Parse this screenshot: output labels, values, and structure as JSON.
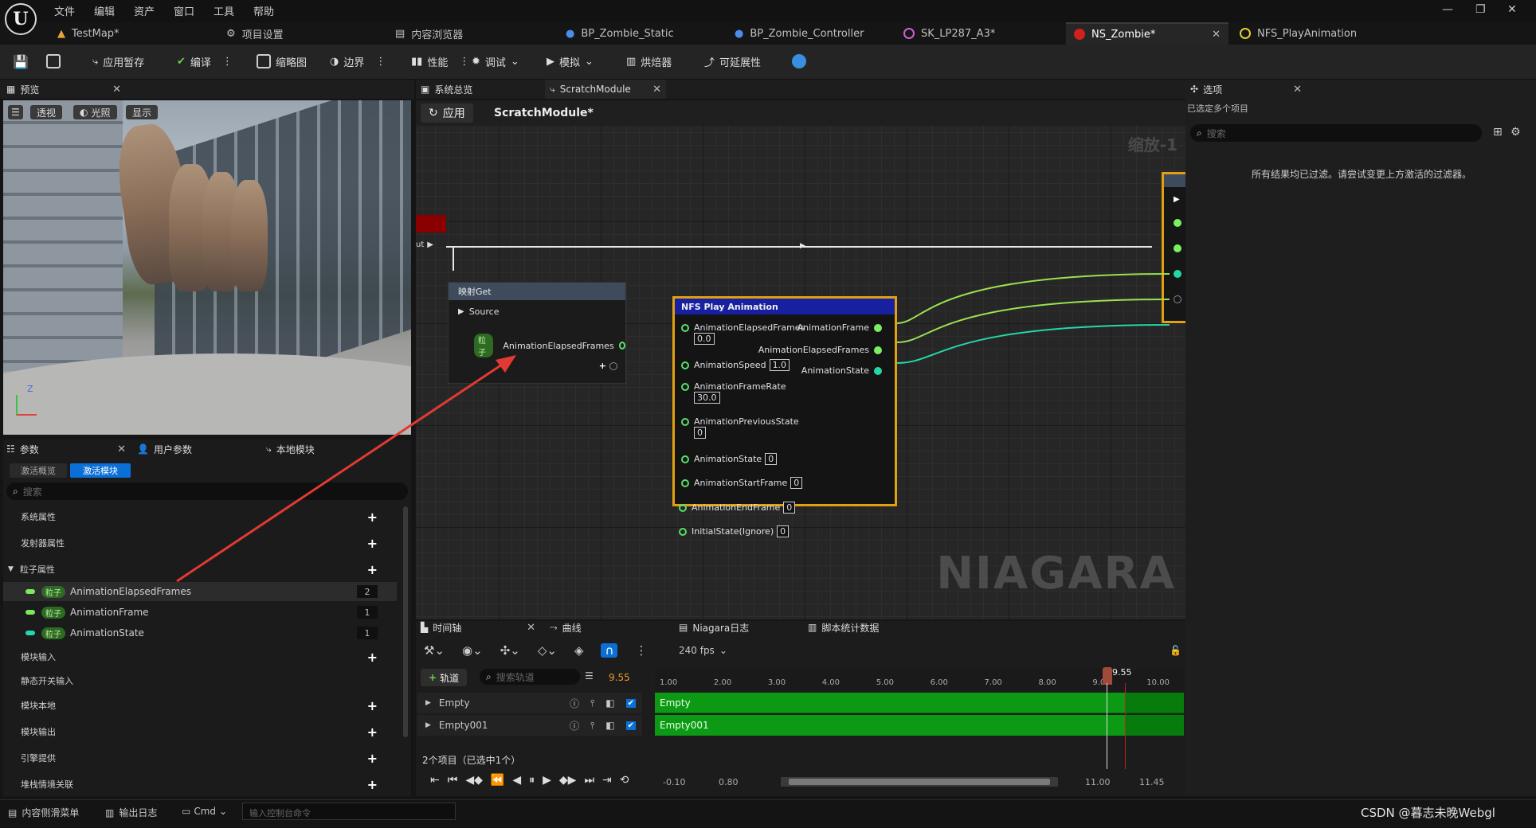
{
  "app": {
    "menu": [
      "文件",
      "编辑",
      "资产",
      "窗口",
      "工具",
      "帮助"
    ]
  },
  "tabs": [
    {
      "label": "TestMap*"
    },
    {
      "label": "项目设置"
    },
    {
      "label": "内容浏览器"
    },
    {
      "label": "BP_Zombie_Static"
    },
    {
      "label": "BP_Zombie_Controller"
    },
    {
      "label": "SK_LP287_A3*"
    },
    {
      "label": "NS_Zombie*"
    },
    {
      "label": "NFS_PlayAnimation"
    }
  ],
  "toolbar": {
    "apply_temp": "应用暂存",
    "compile": "编译",
    "thumbnail": "缩略图",
    "bounds": "边界",
    "performance": "性能",
    "debug": "调试",
    "simulate": "模拟",
    "baker": "烘焙器",
    "scalability": "可延展性"
  },
  "preview": {
    "tab": "预览",
    "buttons": [
      "透视",
      "光照",
      "显示"
    ],
    "axis_z": "Z"
  },
  "params": {
    "tabs": [
      "参数",
      "用户参数",
      "本地模块"
    ],
    "seg": [
      "激活概览",
      "激活模块"
    ],
    "search_placeholder": "搜索",
    "rows": [
      {
        "label": "系统属性"
      },
      {
        "label": "发射器属性"
      },
      {
        "label": "粒子属性"
      },
      {
        "label": "AnimationElapsedFrames",
        "badge": "粒子",
        "count": "2",
        "color": "#7ce85a"
      },
      {
        "label": "AnimationFrame",
        "badge": "粒子",
        "count": "1",
        "color": "#7ce85a"
      },
      {
        "label": "AnimationState",
        "badge": "粒子",
        "count": "1",
        "color": "#24d7a8"
      },
      {
        "label": "模块输入"
      },
      {
        "label": "静态开关输入"
      },
      {
        "label": "模块本地"
      },
      {
        "label": "模块输出"
      },
      {
        "label": "引擎提供"
      },
      {
        "label": "堆栈情境关联"
      }
    ]
  },
  "graph": {
    "tabs": [
      "系统总览",
      "ScratchModule"
    ],
    "apply_label": "应用",
    "module_title": "ScratchModule*",
    "zoom": "缩放-1",
    "watermark": "NIAGARA",
    "exec_out": "ut",
    "map_get": {
      "title": "映射Get",
      "source": "Source",
      "badge": "粒子",
      "pin": "AnimationElapsedFrames"
    },
    "play_node": {
      "title": "NFS Play Animation",
      "inputs": [
        {
          "name": "AnimationElapsedFrames",
          "value": "0.0"
        },
        {
          "name": "AnimationSpeed",
          "value": "1.0"
        },
        {
          "name": "AnimationFrameRate",
          "value": "30.0"
        },
        {
          "name": "AnimationPreviousState",
          "value": "0"
        },
        {
          "name": "AnimationState",
          "value": "0"
        },
        {
          "name": "AnimationStartFrame",
          "value": "0"
        },
        {
          "name": "AnimationEndFrame",
          "value": "0"
        },
        {
          "name": "InitialState(Ignore)",
          "value": "0"
        }
      ],
      "outputs": [
        "AnimationFrame",
        "AnimationElapsedFrames",
        "AnimationState"
      ]
    }
  },
  "timeline": {
    "tabs": [
      "时间轴",
      "曲线",
      "Niagara日志",
      "脚本统计数据"
    ],
    "fps": "240 fps",
    "add_track": "轨道",
    "search_placeholder": "搜索轨道",
    "current_time": "9.55",
    "playhead": "9.55",
    "ticks": [
      "1.00",
      "2.00",
      "3.00",
      "4.00",
      "5.00",
      "6.00",
      "7.00",
      "8.00",
      "9.00",
      "10.00"
    ],
    "tracks": [
      {
        "name": "Empty"
      },
      {
        "name": "Empty001"
      }
    ],
    "status": "2个项目（已选中1个）",
    "range": [
      "-0.10",
      "0.80",
      "11.00",
      "11.45"
    ]
  },
  "details": {
    "tab": "选项",
    "subtitle": "已选定多个项目",
    "search_placeholder": "搜索",
    "message": "所有结果均已过滤。请尝试变更上方激活的过滤器。"
  },
  "statusbar": {
    "content_drawer": "内容侧滑菜单",
    "output_log": "输出日志",
    "cmd": "Cmd",
    "console_placeholder": "输入控制台命令",
    "watermark": "CSDN @暮志未晚Webgl"
  },
  "colors": {
    "accent": "#0a70d8",
    "node_title_blue": "#1620a0",
    "node_border": "#e0a010",
    "track_green": "#0c9a14",
    "arrow": "#e23a32"
  }
}
